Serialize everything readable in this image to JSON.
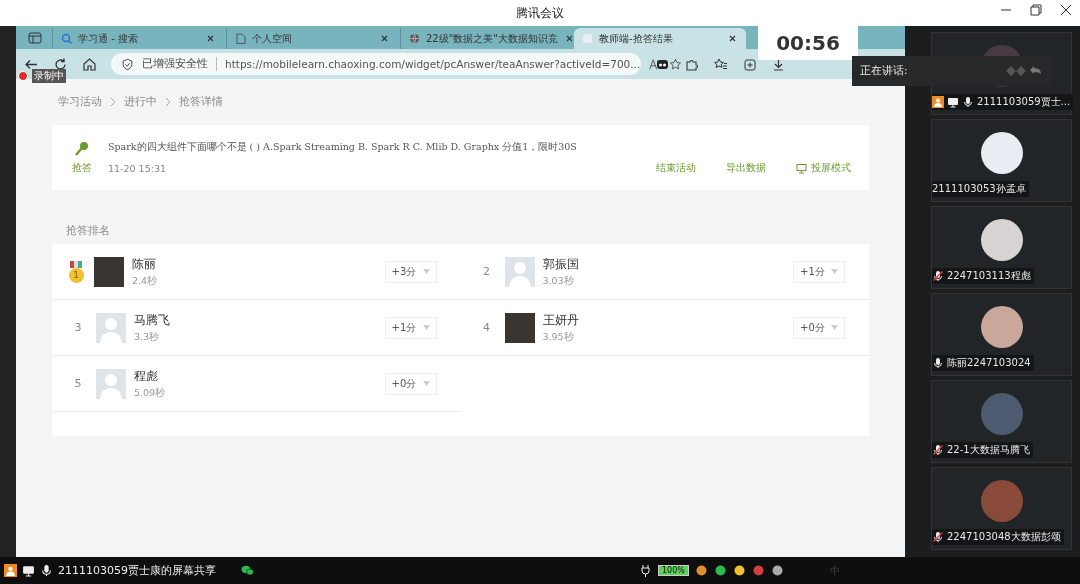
{
  "window": {
    "title": "腾讯会议"
  },
  "recording": {
    "label": "录制中"
  },
  "browser": {
    "tabs": [
      {
        "label": "学习通 - 搜索",
        "selected": false
      },
      {
        "label": "个人空间",
        "selected": false
      },
      {
        "label": "22级\"数据之美\"大数据知识竞",
        "selected": false
      },
      {
        "label": "教师端-抢答结果",
        "selected": true
      }
    ],
    "security": "已增强安全性",
    "url": "https://mobilelearn.chaoxing.com/widget/pcAnswer/teaAnswer?activeId=700..."
  },
  "breadcrumb": [
    "学习活动",
    "进行中",
    "抢答详情"
  ],
  "activity": {
    "type_label": "抢答",
    "question": "Spark的四大组件下面哪个不是 ( ) A.Spark Streaming B. Spark R C. Mlib D. Graphx 分值1，限时30S",
    "time": "11-20 15:31",
    "actions": [
      {
        "label": "结束活动",
        "kind": "text"
      },
      {
        "label": "导出数据",
        "kind": "text"
      },
      {
        "label": "投屏模式",
        "kind": "screen"
      }
    ]
  },
  "ranking": {
    "title": "抢答排名",
    "entries": [
      {
        "rank": "1",
        "kind": "medal",
        "name": "陈丽",
        "time": "2.4秒",
        "score": "+3分",
        "photo": true
      },
      {
        "rank": "2",
        "kind": "plain",
        "name": "郭振国",
        "time": "3.03秒",
        "score": "+1分",
        "photo": false
      },
      {
        "rank": "3",
        "kind": "plain",
        "name": "马腾飞",
        "time": "3.3秒",
        "score": "+1分",
        "photo": false
      },
      {
        "rank": "4",
        "kind": "plain",
        "name": "王妍丹",
        "time": "3.95秒",
        "score": "+0分",
        "photo": true
      },
      {
        "rank": "5",
        "kind": "plain",
        "name": "程彪",
        "time": "5.09秒",
        "score": "+0分",
        "photo": false
      }
    ]
  },
  "timer": "00:56",
  "speaking": {
    "label": "正在讲话:"
  },
  "participants": [
    {
      "name": "2111103059贾士...",
      "host": true,
      "sharing": true,
      "muted": false
    },
    {
      "name": "2111103053孙孟卓",
      "host": false,
      "sharing": false
    },
    {
      "name": "2247103113程彪",
      "host": false,
      "sharing": false,
      "muted": true
    },
    {
      "name": "陈丽2247103024",
      "host": false,
      "sharing": false,
      "muted": false
    },
    {
      "name": "22-1大数据马腾飞",
      "host": false,
      "sharing": false,
      "muted": true
    },
    {
      "name": "2247103048大数据彭颂",
      "host": false,
      "sharing": false,
      "muted": true
    }
  ],
  "taskbar": {
    "host": true,
    "sharing": true,
    "muted": false,
    "share_label": "2111103059贾士康的屏幕共享",
    "battery": "100%",
    "ime": "中"
  }
}
